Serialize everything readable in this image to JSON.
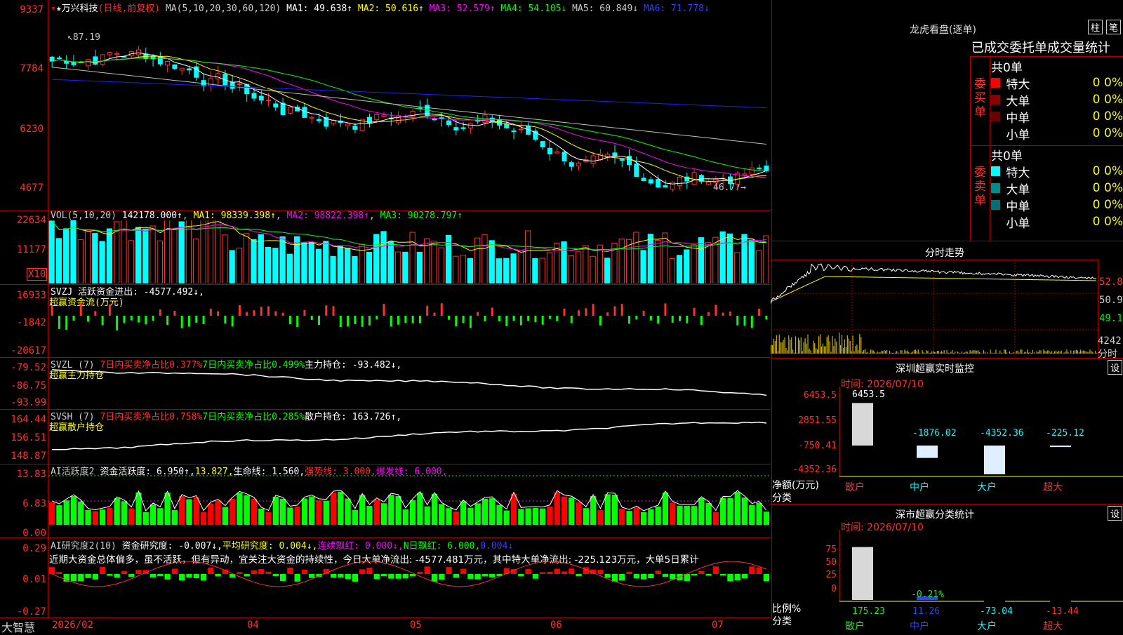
{
  "app": {
    "name": "大智慧"
  },
  "stock": {
    "title": "★万兴科技",
    "mode": "(日线,前复权)",
    "high_label": "87.19",
    "low_label": "46.77"
  },
  "ma": {
    "label": "MA(5,10,20,30,60,120)",
    "ma1": "MA1: 49.638↑",
    "ma2": "MA2: 50.616↑",
    "ma3": "MA3: 52.579↑",
    "ma4": "MA4: 54.105↓",
    "ma5": "MA5: 60.849↓",
    "ma6": "MA6: 71.778↓"
  },
  "price_axis": [
    "9337",
    "7784",
    "6230",
    "4677"
  ],
  "vol": {
    "label": "VOL(5,10,20)",
    "value": "142178.000↑",
    "ma1": "MA1: 98339.398↑",
    "ma2": "MA2: 98822.398↑",
    "ma3": "MA3: 90278.797↑",
    "axis": [
      "22634",
      "11177"
    ],
    "unit": "X10"
  },
  "svzj": {
    "label": "SVZJ",
    "text": "活跃资金进出: -4577.492↓,",
    "sub": "超赢资金流(万元)",
    "axis": [
      "16933",
      "-1842",
      "-20617"
    ]
  },
  "svzl": {
    "label": "SVZL (7)",
    "t1": "7日内买卖净占比0.377%",
    "t2": "7日内买卖净占比0.499%",
    "t3": "主力持仓: -93.482↓,",
    "sub": "超赢主力持仓",
    "axis": [
      "-79.52",
      "-86.75",
      "-93.99"
    ]
  },
  "svsh": {
    "label": "SVSH (7)",
    "t1": "7日内买卖净占比0.758%",
    "t2": "7日内买卖净占比0.285%",
    "t3": "散户持仓: 163.726↑,",
    "sub": "超赢散户持仓",
    "axis": [
      "164.44",
      "156.51",
      "148.87"
    ]
  },
  "ai1": {
    "label": "AI活跃度2",
    "t1": "资金活跃度: 6.950↑,",
    "t2": "13.827,",
    "t3": "生命线: 1.560,",
    "t4": "强势线: 3.000,",
    "t5": "爆发线: 6.000,",
    "axis": [
      "13.83",
      "6.83",
      "0.00"
    ]
  },
  "ai2": {
    "label": "AI研究度2(10)",
    "t1": "资金研究度: -0.007↓,",
    "t2": "平均研究度: 0.004↓,",
    "t3": "连续飘红: 0.000↓,",
    "t4": "N日飘红: 6.000,",
    "t5": "0.004↓",
    "note": "近期大资金总体偏多，虽不活跃，但有异动，宜关注大资金的持续性，今日大单净流出: -4577.481万元，其中特大单净流出: -225.123万元，大单5日累计",
    "axis": [
      "0.29",
      "0.01",
      "-0.27"
    ]
  },
  "dates": [
    "2026/02",
    "04",
    "05",
    "06",
    "07"
  ],
  "lhk": {
    "title": "龙虎看盘(逐单)",
    "btn1": "柱",
    "btn2": "笔",
    "header": "已成交委托单成交量统计",
    "buy": {
      "side": "委买单",
      "total": "共0单",
      "rows": [
        {
          "name": "特大",
          "v": "0",
          "p": "0%",
          "color": "#ff0000"
        },
        {
          "name": "大单",
          "v": "0",
          "p": "0%",
          "color": "#8a0000"
        },
        {
          "name": "中单",
          "v": "0",
          "p": "0%",
          "color": "#6a0000"
        },
        {
          "name": "小单",
          "v": "0",
          "p": "0%",
          "color": "#000000"
        }
      ]
    },
    "sell": {
      "side": "委卖单",
      "total": "共0单",
      "rows": [
        {
          "name": "特大",
          "v": "0",
          "p": "0%",
          "color": "#00ffff"
        },
        {
          "name": "大单",
          "v": "0",
          "p": "0%",
          "color": "#008b8b"
        },
        {
          "name": "中单",
          "v": "0",
          "p": "0%",
          "color": "#007070"
        },
        {
          "name": "小单",
          "v": "0",
          "p": "0%",
          "color": "#000000"
        }
      ]
    }
  },
  "intraday": {
    "title": "分时走势",
    "axis": [
      "52.80",
      "50.96",
      "49.12"
    ],
    "vol": "4242",
    "vol_unit": "分时"
  },
  "monitor": {
    "title": "深圳超赢实时监控",
    "btn": "设",
    "time": "时间: 2026/07/10",
    "axis": [
      "6453.5",
      "2851.55",
      "-750.41",
      "-4352.36"
    ],
    "ylabel": "净额(万元)",
    "xlabel": "分类",
    "bars": [
      {
        "name": "散户",
        "value": 6453.5,
        "label": "6453.5"
      },
      {
        "name": "中户",
        "value": -1876.02,
        "label": "-1876.02"
      },
      {
        "name": "大户",
        "value": -4352.36,
        "label": "-4352.36"
      },
      {
        "name": "超大",
        "value": -225.12,
        "label": "-225.12"
      }
    ]
  },
  "classify": {
    "title": "深市超赢分类统计",
    "btn": "设",
    "time": "时间: 2026/07/10",
    "axis": [
      "75",
      "50",
      "25",
      "0"
    ],
    "ylabel": "比例%",
    "xlabel": "分类",
    "bars": [
      {
        "name": "散户",
        "value": 175.23,
        "label": "175.23"
      },
      {
        "name": "中户",
        "value": 11.26,
        "label": "11.26"
      },
      {
        "name": "大户",
        "value": -73.04,
        "label": "-73.04"
      },
      {
        "name": "超大",
        "value": -13.44,
        "label": "-13.44"
      }
    ],
    "mid_label": "-0.21%"
  },
  "colors": {
    "up": "#ff3030",
    "down": "#00ffff",
    "green": "#00ff00",
    "frame": "#aa0000",
    "ma1": "#ffffff",
    "ma2": "#ffff00",
    "ma3": "#ff00ff",
    "ma4": "#00ff00",
    "ma5": "#c0c0c0",
    "ma6": "#2020ff"
  }
}
